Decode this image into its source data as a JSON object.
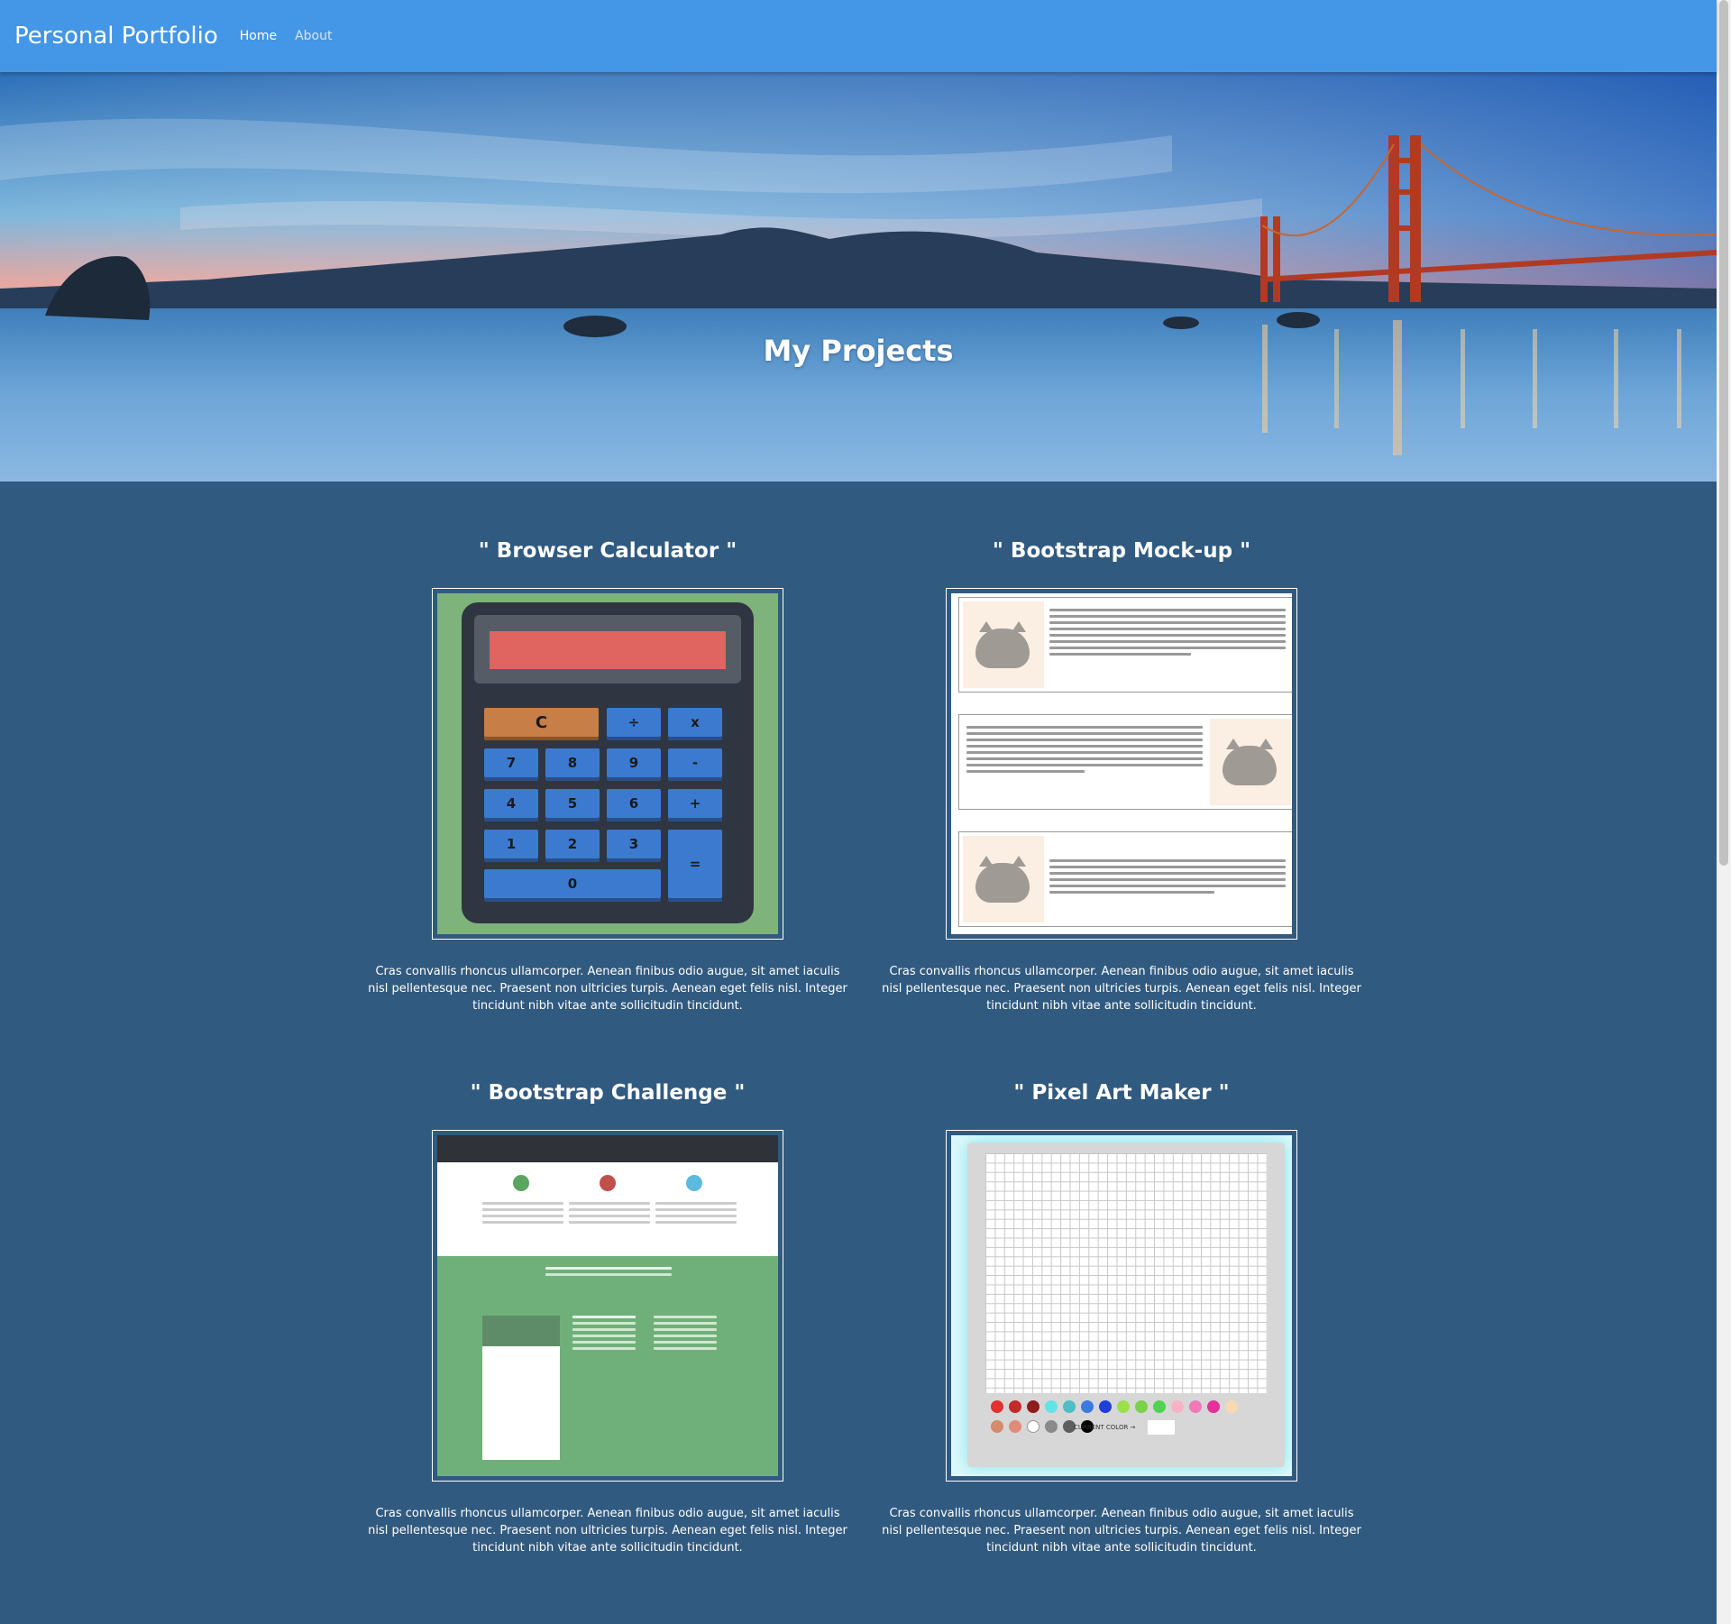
{
  "navbar": {
    "brand": "Personal Portfolio",
    "links": [
      {
        "label": "Home",
        "active": true
      },
      {
        "label": "About",
        "active": false
      }
    ]
  },
  "hero": {
    "title": "My Projects"
  },
  "projects": [
    {
      "title": "\" Browser Calculator \"",
      "description": "Cras convallis rhoncus ullamcorper. Aenean finibus odio augue, sit amet iaculis nisl pellentesque nec. Praesent non ultricies turpis. Aenean eget felis nisl. Integer tincidunt nibh vitae ante sollicitudin tincidunt.",
      "thumbnail": {
        "keys": [
          "C",
          "÷",
          "x",
          "7",
          "8",
          "9",
          "-",
          "4",
          "5",
          "6",
          "+",
          "1",
          "2",
          "3",
          "=",
          "0"
        ]
      }
    },
    {
      "title": "\" Bootstrap Mock-up \"",
      "description": "Cras convallis rhoncus ullamcorper. Aenean finibus odio augue, sit amet iaculis nisl pellentesque nec. Praesent non ultricies turpis. Aenean eget felis nisl. Integer tincidunt nibh vitae ante sollicitudin tincidunt."
    },
    {
      "title": "\" Bootstrap Challenge \"",
      "description": "Cras convallis rhoncus ullamcorper. Aenean finibus odio augue, sit amet iaculis nisl pellentesque nec. Praesent non ultricies turpis. Aenean eget felis nisl. Integer tincidunt nibh vitae ante sollicitudin tincidunt."
    },
    {
      "title": "\" Pixel Art Maker \"",
      "description": "Cras convallis rhoncus ullamcorper. Aenean finibus odio augue, sit amet iaculis nisl pellentesque nec. Praesent non ultricies turpis. Aenean eget felis nisl. Integer tincidunt nibh vitae ante sollicitudin tincidunt.",
      "thumbnail": {
        "current_color_label": "CURRENT COLOR →",
        "palette": [
          "#e33030",
          "#c42b2b",
          "#8e1c1c",
          "#62e3e8",
          "#4fbcc6",
          "#3a7be0",
          "#1f3fd6",
          "#9be04a",
          "#7ad24c",
          "#4fd350",
          "#f7b3c4",
          "#f07ab8",
          "#e5309b",
          "#f7d9b3",
          "#d48b6a",
          "#e28a7a",
          "#ffffff",
          "#8a8a8a",
          "#5e5e5e",
          "#000000"
        ]
      }
    }
  ],
  "colors": {
    "navbar": "#4496e6",
    "page_background": "#315a80"
  }
}
